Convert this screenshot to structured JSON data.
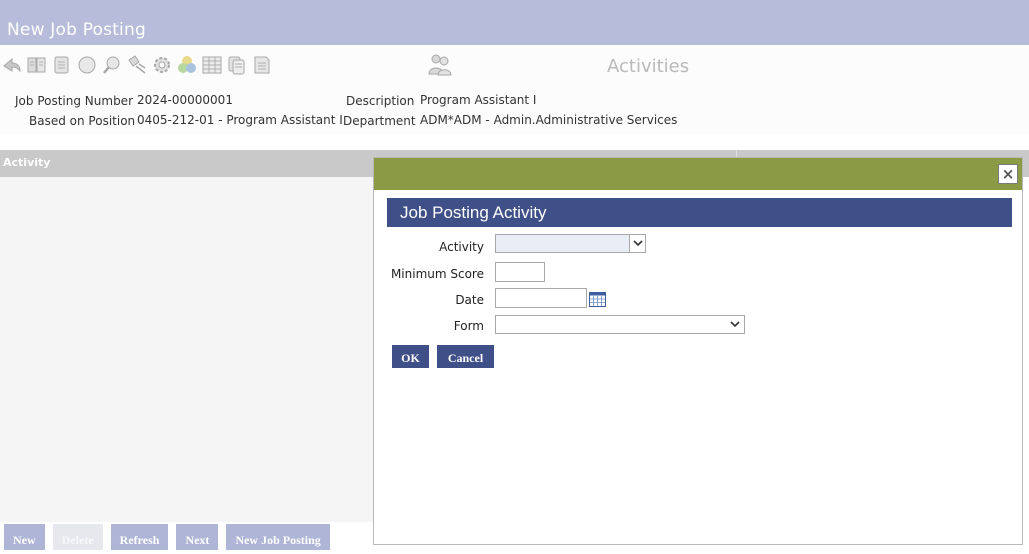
{
  "window": {
    "title": "New Job Posting"
  },
  "toolbar": {
    "icons": [
      "back-icon",
      "book-icon",
      "document-icon",
      "circle-icon",
      "search-icon",
      "satellite-icon",
      "gear-icon",
      "color-wheel-icon",
      "table-icon",
      "documents-icon",
      "page-icon"
    ],
    "section_icon": "group-icon",
    "section_title": "Activities"
  },
  "info": {
    "job_posting_number_label": "Job Posting Number",
    "job_posting_number": "2024-00000001",
    "based_on_position_label": "Based on Position",
    "based_on_position": "0405-212-01 - Program Assistant I",
    "description_label": "Description",
    "description": "Program Assistant I",
    "department_label": "Department",
    "department": "ADM*ADM - Admin.Administrative Services"
  },
  "grid": {
    "columns": [
      "Activity"
    ]
  },
  "bottom_buttons": {
    "new": "New",
    "delete": "Delete",
    "refresh": "Refresh",
    "next": "Next",
    "new_job_posting": "New Job Posting"
  },
  "modal": {
    "close": "×",
    "title": "Job Posting Activity",
    "fields": {
      "activity_label": "Activity",
      "activity_value": "",
      "minimum_score_label": "Minimum Score",
      "minimum_score_value": "",
      "date_label": "Date",
      "date_value": "",
      "form_label": "Form",
      "form_value": ""
    },
    "ok": "OK",
    "cancel": "Cancel"
  },
  "colors": {
    "title_bar": "#b6bcd9",
    "modal_top": "#8b9a44",
    "modal_header": "#3f4f87",
    "button": "#3f4f87"
  }
}
